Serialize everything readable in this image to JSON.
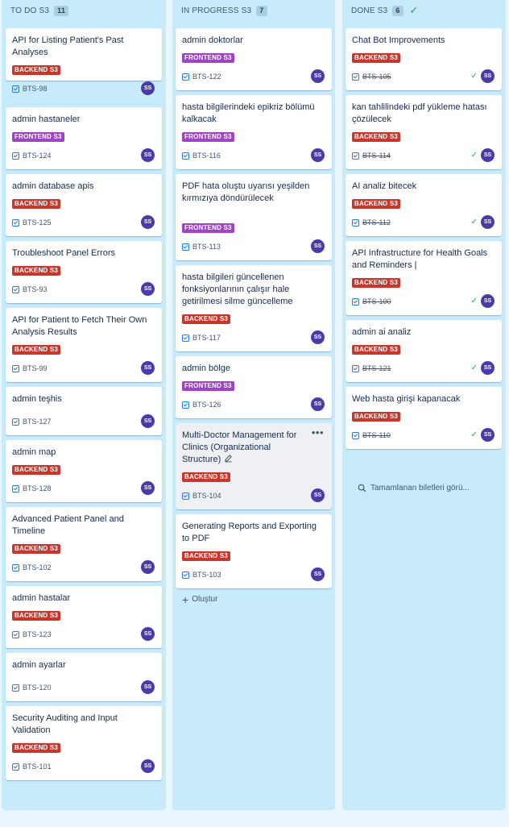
{
  "columns": {
    "todo": {
      "title": "TO DO S3",
      "count": "11",
      "cards": [
        {
          "title": "API for Listing Patient's Past Analyses",
          "label": "BACKEND S3",
          "key": "BTS-98",
          "avatar": "SS"
        },
        {
          "title": "admin hastaneler",
          "label": "FRONTEND S3",
          "key": "BTS-124",
          "avatar": "SS"
        },
        {
          "title": "admin database apis",
          "label": "BACKEND S3",
          "key": "BTS-125",
          "avatar": "SS"
        },
        {
          "title": "Troubleshoot Panel Errors",
          "label": "BACKEND S3",
          "key": "BTS-93",
          "avatar": "SS"
        },
        {
          "title": "API for Patient to Fetch Their Own Analysis Results",
          "label": "BACKEND S3",
          "key": "BTS-99",
          "avatar": "SS"
        },
        {
          "title": "admin teşhis",
          "label": "",
          "key": "BTS-127",
          "avatar": "SS"
        },
        {
          "title": "admin map",
          "label": "BACKEND S3",
          "key": "BTS-128",
          "avatar": "SS"
        },
        {
          "title": "Advanced Patient Panel and Timeline",
          "label": "BACKEND S3",
          "key": "BTS-102",
          "avatar": "SS"
        },
        {
          "title": "admin hastalar",
          "label": "BACKEND S3",
          "key": "BTS-123",
          "avatar": "SS"
        },
        {
          "title": "admin ayarlar",
          "label": "",
          "key": "BTS-120",
          "avatar": "SS"
        },
        {
          "title": "Security Auditing and Input Validation",
          "label": "BACKEND S3",
          "key": "BTS-101",
          "avatar": "SS"
        }
      ]
    },
    "in_progress": {
      "title": "IN PROGRESS S3",
      "count": "7",
      "cards": [
        {
          "title": "admin doktorlar",
          "label": "FRONTEND S3",
          "key": "BTS-122",
          "avatar": "SS"
        },
        {
          "title": "hasta bilgilerindeki epikriz bölümü kalkacak",
          "label": "FRONTEND S3",
          "key": "BTS-116",
          "avatar": "SS"
        },
        {
          "title": "PDF hata oluştu uyarısı yeşilden kırmızıya döndürülecek",
          "label": "FRONTEND S3",
          "key": "BTS-113",
          "avatar": "SS"
        },
        {
          "title": "hasta bilgileri güncellenen fonksiyonlarının çalışır hale getirilmesi silme güncelleme",
          "label": "BACKEND S3",
          "key": "BTS-117",
          "avatar": "SS"
        },
        {
          "title": "admin bölge",
          "label": "FRONTEND S3",
          "key": "BTS-126",
          "avatar": "SS"
        },
        {
          "title": "Multi-Doctor Management for Clinics (Organizational Structure)",
          "label": "BACKEND S3",
          "key": "BTS-104",
          "avatar": "SS"
        },
        {
          "title": "Generating Reports and Exporting to PDF",
          "label": "BACKEND S3",
          "key": "BTS-103",
          "avatar": "SS"
        }
      ],
      "create_label": "Oluştur"
    },
    "done": {
      "title": "DONE S3",
      "count": "6",
      "cards": [
        {
          "title": "Chat Bot Improvements",
          "label": "BACKEND S3",
          "key": "BTS-105",
          "avatar": "SS"
        },
        {
          "title": "kan tahlilindeki pdf yükleme hatası çözülecek",
          "label": "BACKEND S3",
          "key": "BTS-114",
          "avatar": "SS"
        },
        {
          "title": "AI analiz bitecek",
          "label": "BACKEND S3",
          "key": "BTS-112",
          "avatar": "SS"
        },
        {
          "title": "API Infrastructure for Health Goals and Reminders |",
          "label": "BACKEND S3",
          "key": "BTS-100",
          "avatar": "SS"
        },
        {
          "title": "admin ai analiz",
          "label": "BACKEND S3",
          "key": "BTS-121",
          "avatar": "SS"
        },
        {
          "title": "Web hasta girişi kapanacak",
          "label": "BACKEND S3",
          "key": "BTS-110",
          "avatar": "SS"
        }
      ],
      "show_done_label": "Tamamlanan biletleri görü..."
    }
  },
  "colors": {
    "backend_label": "#c9372c",
    "frontend_label": "#9f45c3",
    "avatar": "#4b3aa8",
    "column_bg": "#c7ebfa"
  }
}
